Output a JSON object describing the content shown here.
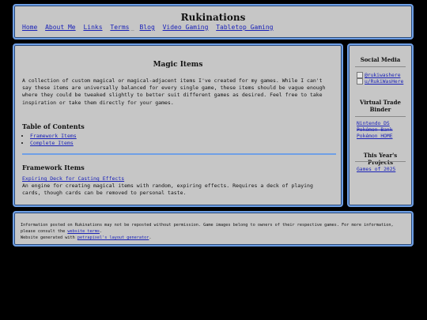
{
  "header": {
    "title": "Rukinations",
    "nav": [
      "Home",
      "About Me",
      "Links",
      "Terms",
      "Blog",
      "Video Gaming",
      "Tabletop Gaming"
    ]
  },
  "main": {
    "title": "Magic Items",
    "intro": "A collection of custom magical or magical-adjacent items I've created for my games. While I can't say these items are universally balanced for every single game, these items should be vague enough where they could be tweaked slightly to better suit different games as desired. Feel free to take inspiration or take them directly for your games.",
    "toc_heading": "Table of Contents",
    "toc": [
      "Framework Items",
      "Complete Items"
    ],
    "framework_heading": "Framework Items",
    "framework_item": {
      "title": "Expiring Deck for Casting Effects",
      "description": "An engine for creating magical items with random, expiring effects. Requires a deck of playing cards, though cards can be removed to personal taste."
    }
  },
  "sidebar": {
    "social_heading": "Social Media",
    "social_links": [
      "@rukiwashere",
      "u/RukiWasHere"
    ],
    "binder_heading": "Virtual Trade Binder",
    "binder_links": [
      "Nintendo DS",
      "Pokémon Bank",
      "Pokémon HOME"
    ],
    "projects_heading": "This Year's Projects",
    "projects_links": [
      "Games of 2025"
    ]
  },
  "footer": {
    "line1_pre": "Information posted on Rukinations may not be reposted without permission. Game images belong to owners of their respective games. For more information, please consult the",
    "line1_link": "website terms",
    "line1_post": ".",
    "line2_pre": "Website generated with",
    "line2_link": "petrapixel's layout generator",
    "line2_post": "."
  }
}
